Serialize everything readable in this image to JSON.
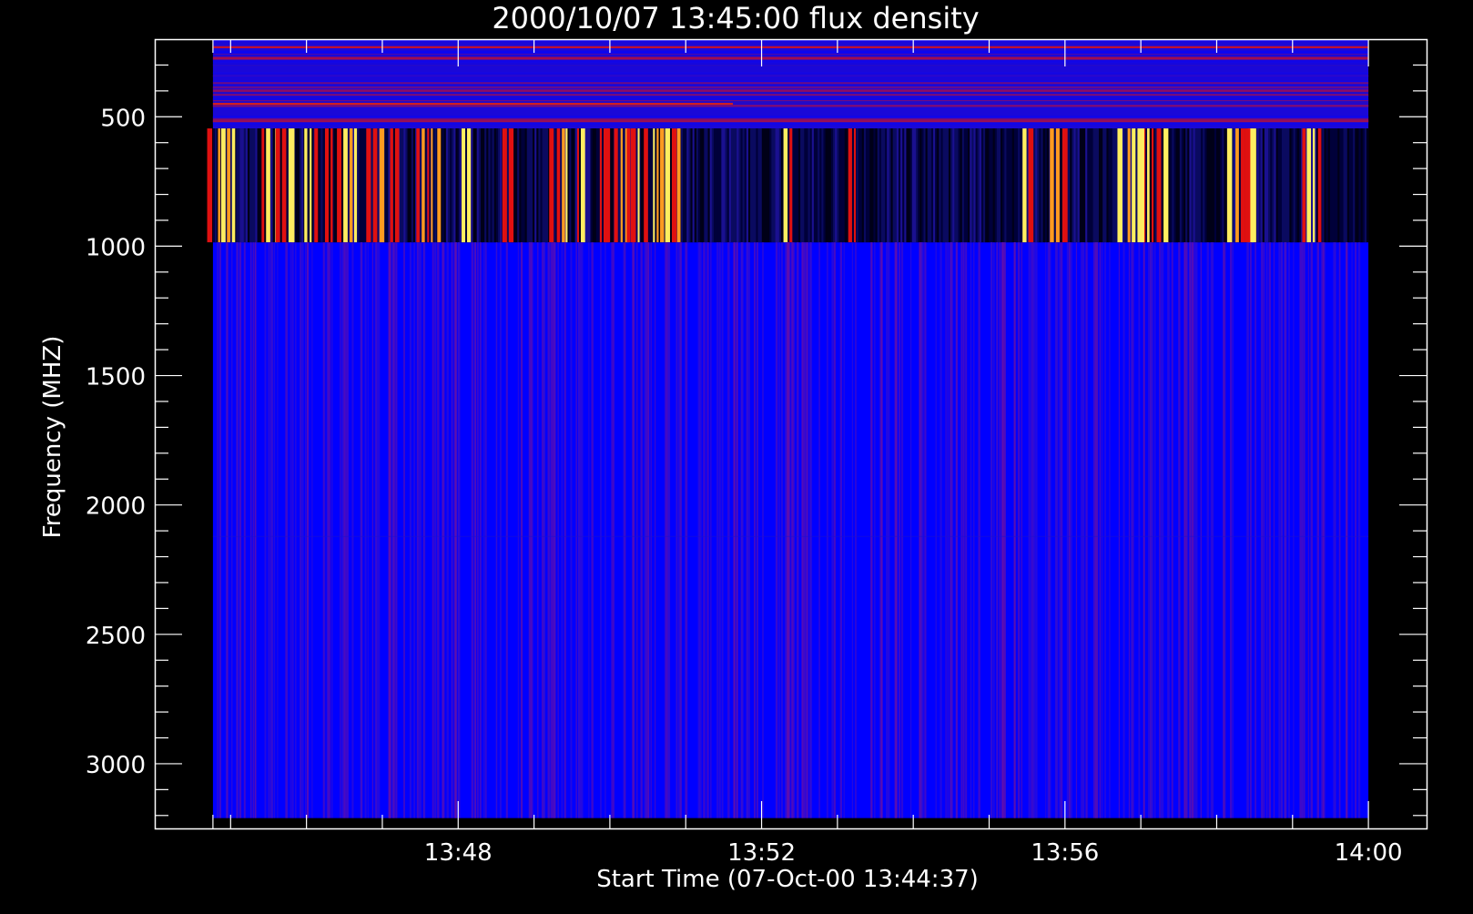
{
  "chart_data": {
    "type": "heatmap",
    "title": "2000/10/07 13:45:00 flux density",
    "xlabel": "Start Time (07-Oct-00 13:44:37)",
    "ylabel": "Frequency (MHZ)",
    "x_ticks": [
      "13:48",
      "13:52",
      "13:56",
      "14:00"
    ],
    "x_tick_minutes": [
      3.383,
      7.383,
      11.383,
      15.383
    ],
    "x_range_minutes": [
      -0.617,
      16.15
    ],
    "data_range_minutes": [
      0.15,
      15.383
    ],
    "y_ticks": [
      "500",
      "1000",
      "1500",
      "2000",
      "2500",
      "3000"
    ],
    "y_tick_values": [
      500,
      1000,
      1500,
      2000,
      2500,
      3000
    ],
    "ylim": [
      200,
      3250
    ],
    "y_reversed": true,
    "data_y_range": [
      200,
      3210
    ],
    "bands": [
      {
        "name": "low",
        "from": 200,
        "to": 545
      },
      {
        "name": "mid",
        "from": 545,
        "to": 985
      },
      {
        "name": "high",
        "from": 985,
        "to": 3210
      }
    ],
    "bright_events_minutes": [
      0.3,
      0.85,
      1.1,
      1.45,
      1.7,
      1.95,
      2.3,
      2.55,
      3.0,
      3.5,
      4.05,
      4.75,
      5.0,
      5.3,
      5.55,
      5.75,
      6.0,
      6.2,
      7.75,
      8.6,
      10.9,
      11.3,
      12.3,
      12.55,
      13.7,
      13.85,
      14.65
    ],
    "colors": {
      "background": "#000000",
      "axes": "#ffffff",
      "quiet": "#0000ff",
      "dark": "#000026",
      "burst_red": "#e01010",
      "burst_yellow": "#ffee60"
    }
  }
}
